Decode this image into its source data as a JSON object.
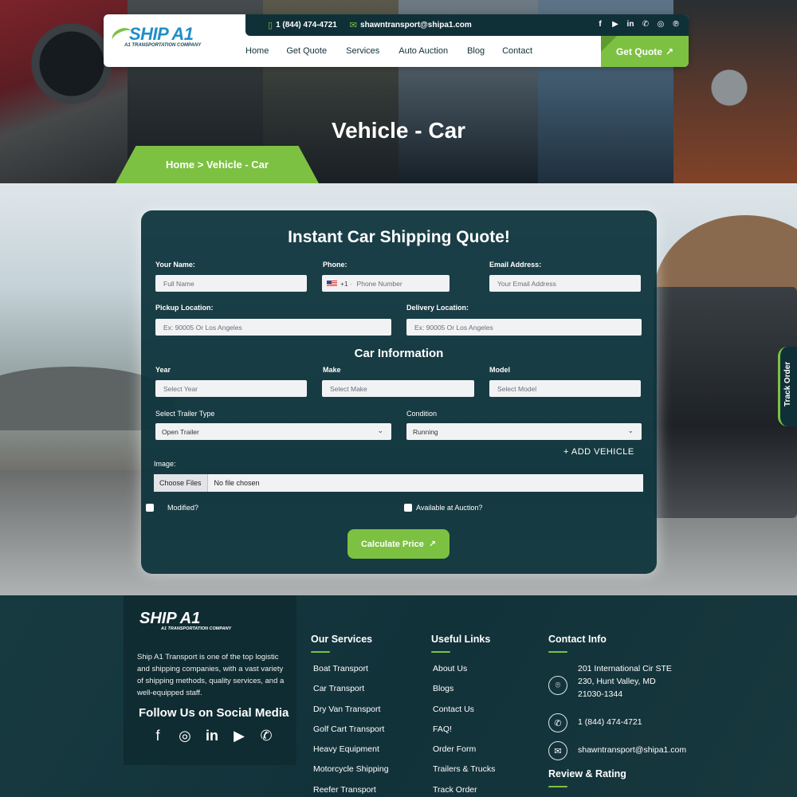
{
  "header": {
    "logo_brand": "SHIP A1",
    "logo_tagline": "A1 TRANSPORTATION COMPANY",
    "phone": "1 (844) 474-4721",
    "email": "shawntransport@shipa1.com",
    "nav": [
      "Home",
      "Get Quote",
      "Services",
      "Auto Auction",
      "Blog",
      "Contact"
    ],
    "cta": "Get Quote",
    "socials": [
      "facebook-icon",
      "youtube-icon",
      "linkedin-icon",
      "whatsapp-icon",
      "instagram-icon",
      "pinterest-icon"
    ]
  },
  "hero": {
    "title": "Vehicle - Car",
    "breadcrumb": "Home > Vehicle - Car"
  },
  "track_order": "Track Order",
  "form": {
    "title": "Instant Car Shipping Quote!",
    "name_label": "Your Name:",
    "name_placeholder": "Full Name",
    "phone_label": "Phone:",
    "phone_code": "+1",
    "phone_placeholder": "Phone Number",
    "email_label": "Email Address:",
    "email_placeholder": "Your Email Address",
    "pickup_label": "Pickup Location:",
    "pickup_placeholder": "Ex: 90005 Or Los Angeles",
    "delivery_label": "Delivery Location:",
    "delivery_placeholder": "Ex: 90005 Or Los Angeles",
    "car_section": "Car Information",
    "year_label": "Year",
    "year_placeholder": "Select Year",
    "make_label": "Make",
    "make_placeholder": "Select Make",
    "model_label": "Model",
    "model_placeholder": "Select Model",
    "trailer_label": "Select Trailer Type",
    "trailer_value": "Open Trailer",
    "condition_label": "Condition",
    "condition_value": "Running",
    "add_vehicle": "+ ADD VEHICLE",
    "image_label": "Image:",
    "file_button": "Choose Files",
    "file_status": "No file chosen",
    "modified_label": "Modified?",
    "auction_label": "Available at Auction?",
    "submit": "Calculate Price"
  },
  "footer": {
    "logo_brand": "SHIP A1",
    "logo_tagline": "A1 TRANSPORTATION COMPANY",
    "about": "Ship A1 Transport is one of the top logistic and shipping companies, with a vast variety of shipping methods, quality services, and a well-equipped staff.",
    "follow": "Follow Us on Social Media",
    "services_title": "Our Services",
    "services": [
      "Boat Transport",
      "Car Transport",
      "Dry Van Transport",
      "Golf Cart Transport",
      "Heavy Equipment",
      "Motorcycle Shipping",
      "Reefer Transport"
    ],
    "links_title": "Useful Links",
    "links": [
      "About Us",
      "Blogs",
      "Contact Us",
      "FAQ!",
      "Order Form",
      "Trailers & Trucks",
      "Track Order"
    ],
    "contact_title": "Contact Info",
    "address_line1": "201 International Cir STE",
    "address_line2": "230, Hunt Valley, MD",
    "address_line3": "21030-1344",
    "contact_phone": "1 (844) 474-4721",
    "contact_email": "shawntransport@shipa1.com",
    "review_title": "Review & Rating"
  },
  "colors": {
    "accent": "#7dc142",
    "dark": "#103038"
  }
}
